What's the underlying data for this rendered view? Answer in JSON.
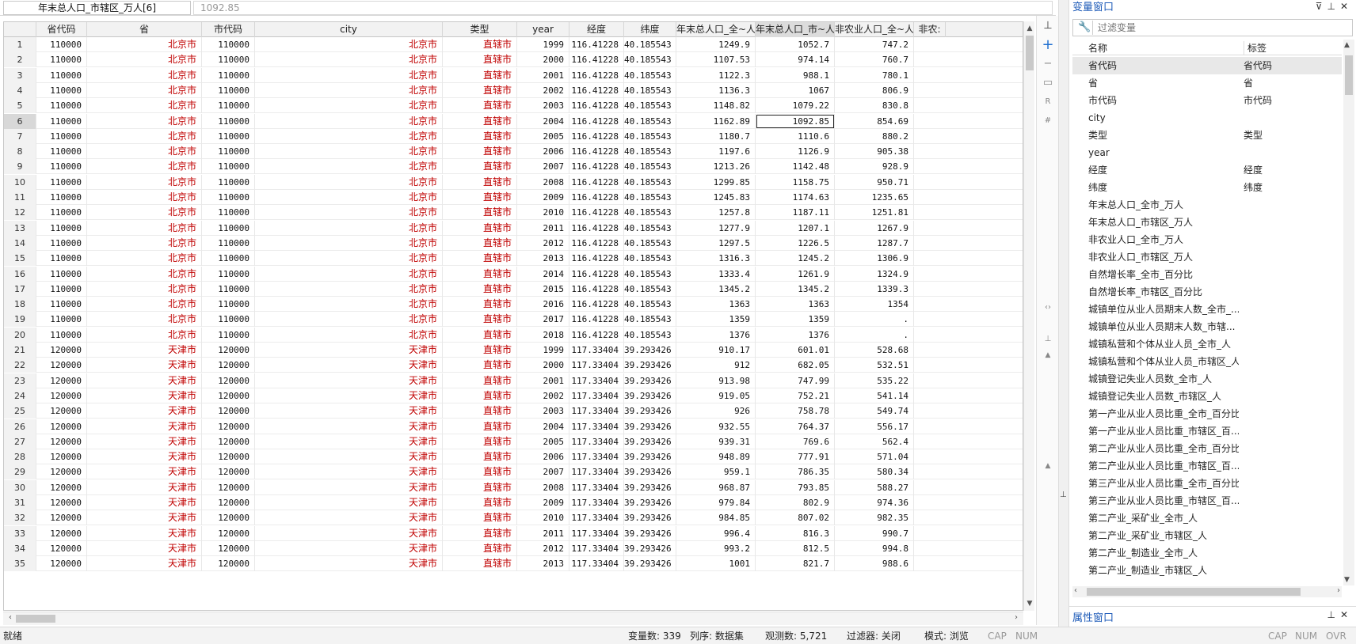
{
  "topbar": {
    "variable_name": "年末总人口_市辖区_万人[6]",
    "cell_value": "1092.85"
  },
  "grid": {
    "columns": [
      "省代码",
      "省",
      "市代码",
      "city",
      "类型",
      "year",
      "经度",
      "纬度",
      "年末总人口_全~人",
      "年末总人口_市~人",
      "非农业人口_全~人",
      "非农:"
    ],
    "rows": [
      [
        "1",
        "110000",
        "北京市",
        "110000",
        "北京市",
        "直辖市",
        "1999",
        "116.41228",
        "40.185543",
        "1249.9",
        "1052.7",
        "747.2"
      ],
      [
        "2",
        "110000",
        "北京市",
        "110000",
        "北京市",
        "直辖市",
        "2000",
        "116.41228",
        "40.185543",
        "1107.53",
        "974.14",
        "760.7"
      ],
      [
        "3",
        "110000",
        "北京市",
        "110000",
        "北京市",
        "直辖市",
        "2001",
        "116.41228",
        "40.185543",
        "1122.3",
        "988.1",
        "780.1"
      ],
      [
        "4",
        "110000",
        "北京市",
        "110000",
        "北京市",
        "直辖市",
        "2002",
        "116.41228",
        "40.185543",
        "1136.3",
        "1067",
        "806.9"
      ],
      [
        "5",
        "110000",
        "北京市",
        "110000",
        "北京市",
        "直辖市",
        "2003",
        "116.41228",
        "40.185543",
        "1148.82",
        "1079.22",
        "830.8"
      ],
      [
        "6",
        "110000",
        "北京市",
        "110000",
        "北京市",
        "直辖市",
        "2004",
        "116.41228",
        "40.185543",
        "1162.89",
        "1092.85",
        "854.69"
      ],
      [
        "7",
        "110000",
        "北京市",
        "110000",
        "北京市",
        "直辖市",
        "2005",
        "116.41228",
        "40.185543",
        "1180.7",
        "1110.6",
        "880.2"
      ],
      [
        "8",
        "110000",
        "北京市",
        "110000",
        "北京市",
        "直辖市",
        "2006",
        "116.41228",
        "40.185543",
        "1197.6",
        "1126.9",
        "905.38"
      ],
      [
        "9",
        "110000",
        "北京市",
        "110000",
        "北京市",
        "直辖市",
        "2007",
        "116.41228",
        "40.185543",
        "1213.26",
        "1142.48",
        "928.9"
      ],
      [
        "10",
        "110000",
        "北京市",
        "110000",
        "北京市",
        "直辖市",
        "2008",
        "116.41228",
        "40.185543",
        "1299.85",
        "1158.75",
        "950.71"
      ],
      [
        "11",
        "110000",
        "北京市",
        "110000",
        "北京市",
        "直辖市",
        "2009",
        "116.41228",
        "40.185543",
        "1245.83",
        "1174.63",
        "1235.65"
      ],
      [
        "12",
        "110000",
        "北京市",
        "110000",
        "北京市",
        "直辖市",
        "2010",
        "116.41228",
        "40.185543",
        "1257.8",
        "1187.11",
        "1251.81"
      ],
      [
        "13",
        "110000",
        "北京市",
        "110000",
        "北京市",
        "直辖市",
        "2011",
        "116.41228",
        "40.185543",
        "1277.9",
        "1207.1",
        "1267.9"
      ],
      [
        "14",
        "110000",
        "北京市",
        "110000",
        "北京市",
        "直辖市",
        "2012",
        "116.41228",
        "40.185543",
        "1297.5",
        "1226.5",
        "1287.7"
      ],
      [
        "15",
        "110000",
        "北京市",
        "110000",
        "北京市",
        "直辖市",
        "2013",
        "116.41228",
        "40.185543",
        "1316.3",
        "1245.2",
        "1306.9"
      ],
      [
        "16",
        "110000",
        "北京市",
        "110000",
        "北京市",
        "直辖市",
        "2014",
        "116.41228",
        "40.185543",
        "1333.4",
        "1261.9",
        "1324.9"
      ],
      [
        "17",
        "110000",
        "北京市",
        "110000",
        "北京市",
        "直辖市",
        "2015",
        "116.41228",
        "40.185543",
        "1345.2",
        "1345.2",
        "1339.3"
      ],
      [
        "18",
        "110000",
        "北京市",
        "110000",
        "北京市",
        "直辖市",
        "2016",
        "116.41228",
        "40.185543",
        "1363",
        "1363",
        "1354"
      ],
      [
        "19",
        "110000",
        "北京市",
        "110000",
        "北京市",
        "直辖市",
        "2017",
        "116.41228",
        "40.185543",
        "1359",
        "1359",
        "."
      ],
      [
        "20",
        "110000",
        "北京市",
        "110000",
        "北京市",
        "直辖市",
        "2018",
        "116.41228",
        "40.185543",
        "1376",
        "1376",
        "."
      ],
      [
        "21",
        "120000",
        "天津市",
        "120000",
        "天津市",
        "直辖市",
        "1999",
        "117.33404",
        "39.293426",
        "910.17",
        "601.01",
        "528.68"
      ],
      [
        "22",
        "120000",
        "天津市",
        "120000",
        "天津市",
        "直辖市",
        "2000",
        "117.33404",
        "39.293426",
        "912",
        "682.05",
        "532.51"
      ],
      [
        "23",
        "120000",
        "天津市",
        "120000",
        "天津市",
        "直辖市",
        "2001",
        "117.33404",
        "39.293426",
        "913.98",
        "747.99",
        "535.22"
      ],
      [
        "24",
        "120000",
        "天津市",
        "120000",
        "天津市",
        "直辖市",
        "2002",
        "117.33404",
        "39.293426",
        "919.05",
        "752.21",
        "541.14"
      ],
      [
        "25",
        "120000",
        "天津市",
        "120000",
        "天津市",
        "直辖市",
        "2003",
        "117.33404",
        "39.293426",
        "926",
        "758.78",
        "549.74"
      ],
      [
        "26",
        "120000",
        "天津市",
        "120000",
        "天津市",
        "直辖市",
        "2004",
        "117.33404",
        "39.293426",
        "932.55",
        "764.37",
        "556.17"
      ],
      [
        "27",
        "120000",
        "天津市",
        "120000",
        "天津市",
        "直辖市",
        "2005",
        "117.33404",
        "39.293426",
        "939.31",
        "769.6",
        "562.4"
      ],
      [
        "28",
        "120000",
        "天津市",
        "120000",
        "天津市",
        "直辖市",
        "2006",
        "117.33404",
        "39.293426",
        "948.89",
        "777.91",
        "571.04"
      ],
      [
        "29",
        "120000",
        "天津市",
        "120000",
        "天津市",
        "直辖市",
        "2007",
        "117.33404",
        "39.293426",
        "959.1",
        "786.35",
        "580.34"
      ],
      [
        "30",
        "120000",
        "天津市",
        "120000",
        "天津市",
        "直辖市",
        "2008",
        "117.33404",
        "39.293426",
        "968.87",
        "793.85",
        "588.27"
      ],
      [
        "31",
        "120000",
        "天津市",
        "120000",
        "天津市",
        "直辖市",
        "2009",
        "117.33404",
        "39.293426",
        "979.84",
        "802.9",
        "974.36"
      ],
      [
        "32",
        "120000",
        "天津市",
        "120000",
        "天津市",
        "直辖市",
        "2010",
        "117.33404",
        "39.293426",
        "984.85",
        "807.02",
        "982.35"
      ],
      [
        "33",
        "120000",
        "天津市",
        "120000",
        "天津市",
        "直辖市",
        "2011",
        "117.33404",
        "39.293426",
        "996.4",
        "816.3",
        "990.7"
      ],
      [
        "34",
        "120000",
        "天津市",
        "120000",
        "天津市",
        "直辖市",
        "2012",
        "117.33404",
        "39.293426",
        "993.2",
        "812.5",
        "994.8"
      ],
      [
        "35",
        "120000",
        "天津市",
        "120000",
        "天津市",
        "直辖市",
        "2013",
        "117.33404",
        "39.293426",
        "1001",
        "821.7",
        "988.6"
      ]
    ]
  },
  "var_panel": {
    "title": "变量窗口",
    "filter_placeholder": "过滤变量",
    "col_name": "名称",
    "col_label": "标签",
    "items": [
      {
        "name": "省代码",
        "label": "省代码"
      },
      {
        "name": "省",
        "label": "省"
      },
      {
        "name": "市代码",
        "label": "市代码"
      },
      {
        "name": "city",
        "label": ""
      },
      {
        "name": "类型",
        "label": "类型"
      },
      {
        "name": "year",
        "label": ""
      },
      {
        "name": "经度",
        "label": "经度"
      },
      {
        "name": "纬度",
        "label": "纬度"
      },
      {
        "name": "年末总人口_全市_万人",
        "label": ""
      },
      {
        "name": "年末总人口_市辖区_万人",
        "label": ""
      },
      {
        "name": "非农业人口_全市_万人",
        "label": ""
      },
      {
        "name": "非农业人口_市辖区_万人",
        "label": ""
      },
      {
        "name": "自然增长率_全市_百分比",
        "label": ""
      },
      {
        "name": "自然增长率_市辖区_百分比",
        "label": ""
      },
      {
        "name": "城镇单位从业人员期末人数_全市_...",
        "label": ""
      },
      {
        "name": "城镇单位从业人员期末人数_市辖...",
        "label": ""
      },
      {
        "name": "城镇私营和个体从业人员_全市_人",
        "label": ""
      },
      {
        "name": "城镇私营和个体从业人员_市辖区_人",
        "label": ""
      },
      {
        "name": "城镇登记失业人员数_全市_人",
        "label": ""
      },
      {
        "name": "城镇登记失业人员数_市辖区_人",
        "label": ""
      },
      {
        "name": "第一产业从业人员比重_全市_百分比",
        "label": ""
      },
      {
        "name": "第一产业从业人员比重_市辖区_百...",
        "label": ""
      },
      {
        "name": "第二产业从业人员比重_全市_百分比",
        "label": ""
      },
      {
        "name": "第二产业从业人员比重_市辖区_百...",
        "label": ""
      },
      {
        "name": "第三产业从业人员比重_全市_百分比",
        "label": ""
      },
      {
        "name": "第三产业从业人员比重_市辖区_百...",
        "label": ""
      },
      {
        "name": "第二产业_采矿业_全市_人",
        "label": ""
      },
      {
        "name": "第二产业_采矿业_市辖区_人",
        "label": ""
      },
      {
        "name": "第二产业_制造业_全市_人",
        "label": ""
      },
      {
        "name": "第二产业_制造业_市辖区_人",
        "label": ""
      }
    ]
  },
  "prop_panel": {
    "title": "属性窗口"
  },
  "status": {
    "ready": "就绪",
    "vars": "变量数: 339",
    "order": "列序: 数据集",
    "obs": "观测数: 5,721",
    "filter": "过滤器: 关闭",
    "mode": "模式: 浏览",
    "cap": "CAP",
    "num": "NUM",
    "ovr": "OVR"
  },
  "icons": {
    "pin": "pin-icon",
    "close": "close-icon",
    "filter": "filter-icon",
    "wrench": "wrench-icon"
  },
  "colors": {
    "string_text": "#c00000",
    "panel_title": "#1e5bb8"
  }
}
